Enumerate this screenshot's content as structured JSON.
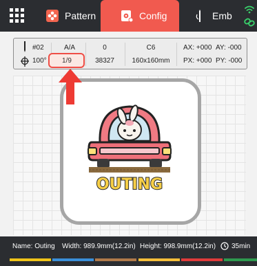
{
  "tabs": [
    {
      "label": "Pattern"
    },
    {
      "label": "Config"
    },
    {
      "label": "Emb"
    }
  ],
  "info": {
    "needle": "#02",
    "angle": "100°",
    "color_seq": "A/A",
    "step": "1/9",
    "col0": "0",
    "stitches": "38327",
    "hoop": "C6",
    "hoop_size": "160x160mm",
    "ax": "AX: +000",
    "ay": "AY: -000",
    "px": "PX: +000",
    "py": "PY: -000"
  },
  "design": {
    "text": "OUTING"
  },
  "status": {
    "name": "Name: Outing",
    "width": "Width: 989.9mm(12.2in)",
    "height": "Height: 998.9mm(12.2in)",
    "time": "35min"
  },
  "color_bar": [
    "#f0c419",
    "#3a8fd9",
    "#b07a4a",
    "#f6bf3a",
    "#e13b3b",
    "#2e9a4f"
  ],
  "colors": {
    "accent": "#f15a4f",
    "bar": "#2b2d31"
  }
}
